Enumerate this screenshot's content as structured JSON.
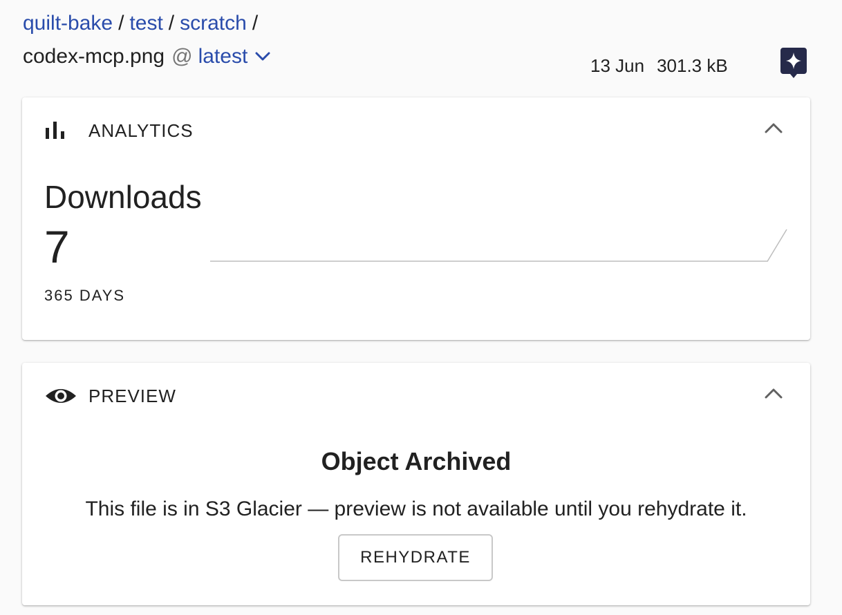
{
  "breadcrumb": {
    "items": [
      {
        "label": "quilt-bake"
      },
      {
        "label": "test"
      },
      {
        "label": "scratch"
      }
    ],
    "separator": "/"
  },
  "file": {
    "name": "codex-mcp.png",
    "at": "@",
    "version": "latest",
    "date": "13 Jun",
    "size": "301.3 kB"
  },
  "analytics": {
    "header": "ANALYTICS",
    "title": "Downloads",
    "count": "7",
    "period": "365 DAYS",
    "sparkline": [
      0,
      0,
      0,
      0,
      0,
      0,
      0,
      0,
      0,
      0,
      0,
      0,
      0,
      0,
      0,
      0,
      0,
      0,
      0,
      0,
      0,
      0,
      0,
      0,
      0,
      0,
      0,
      0,
      0,
      0,
      7
    ]
  },
  "preview": {
    "header": "PREVIEW",
    "title": "Object Archived",
    "message": "This file is in S3 Glacier — preview is not available until you rehydrate it.",
    "button": "REHYDRATE"
  },
  "icons": {
    "version_dropdown": "chevron-down-icon",
    "assistant": "sparkle-icon",
    "analytics": "bar-chart-icon",
    "preview": "eye-icon",
    "collapse": "chevron-up-icon"
  },
  "colors": {
    "link": "#2a4cab",
    "assistant_badge": "#262a4a",
    "text": "#212121",
    "background": "#fafafa"
  }
}
